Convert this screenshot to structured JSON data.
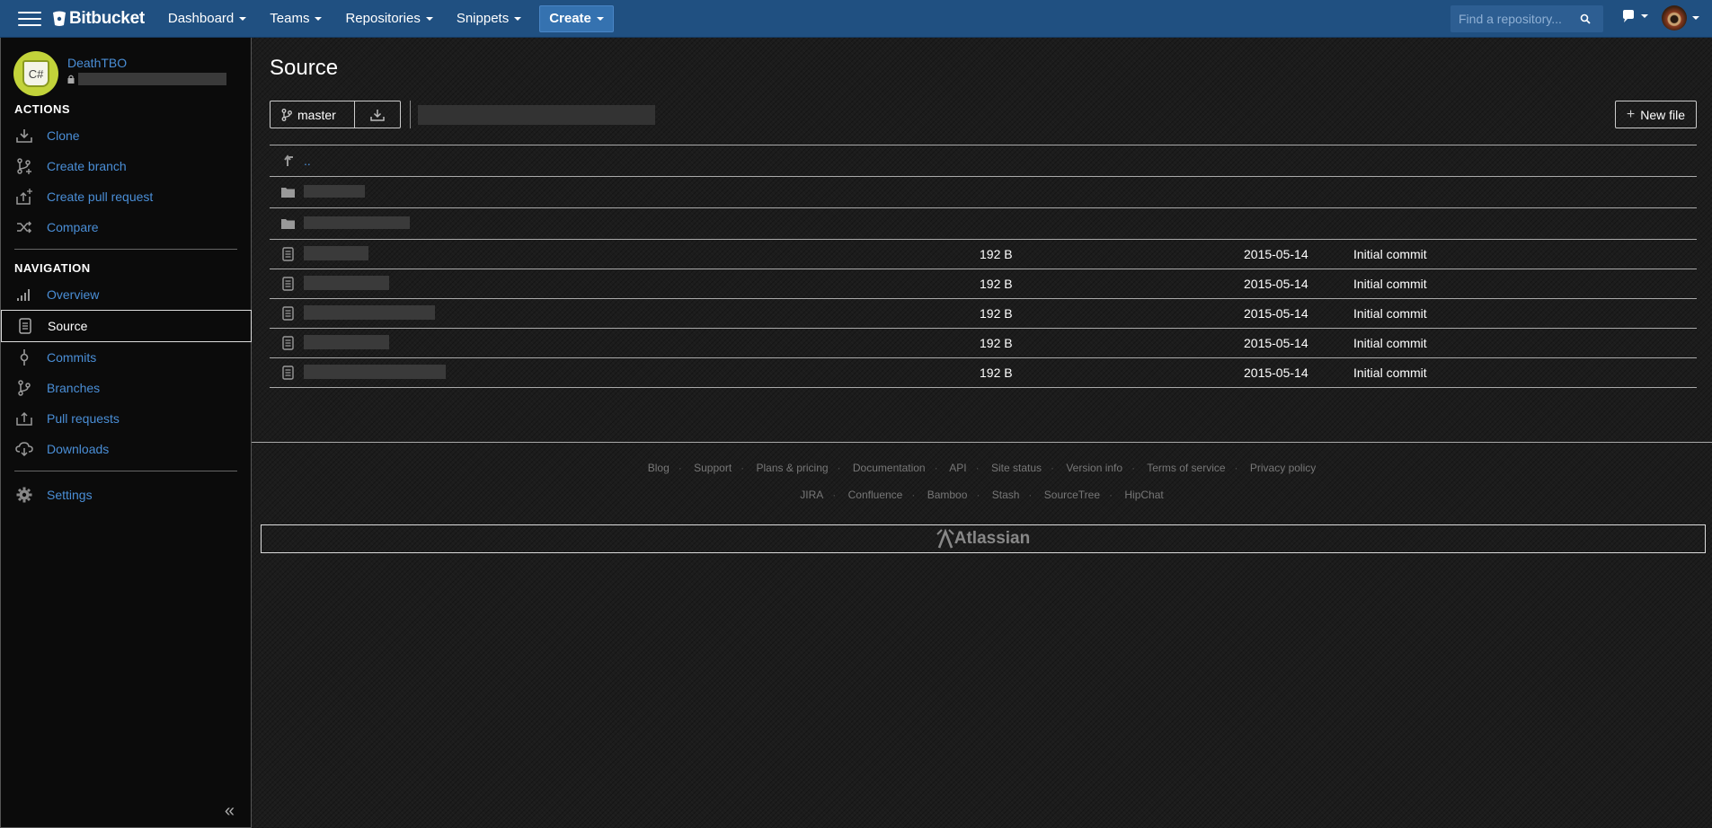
{
  "topbar": {
    "brand": "Bitbucket",
    "nav": [
      "Dashboard",
      "Teams",
      "Repositories",
      "Snippets"
    ],
    "create_label": "Create",
    "search_placeholder": "Find a repository..."
  },
  "sidebar": {
    "repo_owner": "DeathTBO",
    "repo_avatar_text": "C#",
    "actions_heading": "ACTIONS",
    "actions": [
      {
        "label": "Clone",
        "icon": "download-icon"
      },
      {
        "label": "Create branch",
        "icon": "branch-icon"
      },
      {
        "label": "Create pull request",
        "icon": "pull-request-icon"
      },
      {
        "label": "Compare",
        "icon": "compare-icon"
      }
    ],
    "navigation_heading": "NAVIGATION",
    "navigation": [
      {
        "label": "Overview",
        "icon": "overview-icon"
      },
      {
        "label": "Source",
        "icon": "source-icon",
        "active": true
      },
      {
        "label": "Commits",
        "icon": "commit-icon"
      },
      {
        "label": "Branches",
        "icon": "branch-icon"
      },
      {
        "label": "Pull requests",
        "icon": "pull-request-icon"
      },
      {
        "label": "Downloads",
        "icon": "cloud-download-icon"
      }
    ],
    "settings_label": "Settings",
    "collapse_glyph": "«"
  },
  "main": {
    "title": "Source",
    "branch": "master",
    "new_file_label": "New file",
    "parent_dir_label": "..",
    "files": [
      {
        "size": "192 B",
        "date": "2015-05-14",
        "message": "Initial commit"
      },
      {
        "size": "192 B",
        "date": "2015-05-14",
        "message": "Initial commit"
      },
      {
        "size": "192 B",
        "date": "2015-05-14",
        "message": "Initial commit"
      },
      {
        "size": "192 B",
        "date": "2015-05-14",
        "message": "Initial commit"
      },
      {
        "size": "192 B",
        "date": "2015-05-14",
        "message": "Initial commit"
      }
    ]
  },
  "footer": {
    "links1": [
      "Blog",
      "Support",
      "Plans & pricing",
      "Documentation",
      "API",
      "Site status",
      "Version info",
      "Terms of service",
      "Privacy policy"
    ],
    "links2": [
      "JIRA",
      "Confluence",
      "Bamboo",
      "Stash",
      "SourceTree",
      "HipChat"
    ],
    "atlassian": "Atlassian"
  }
}
